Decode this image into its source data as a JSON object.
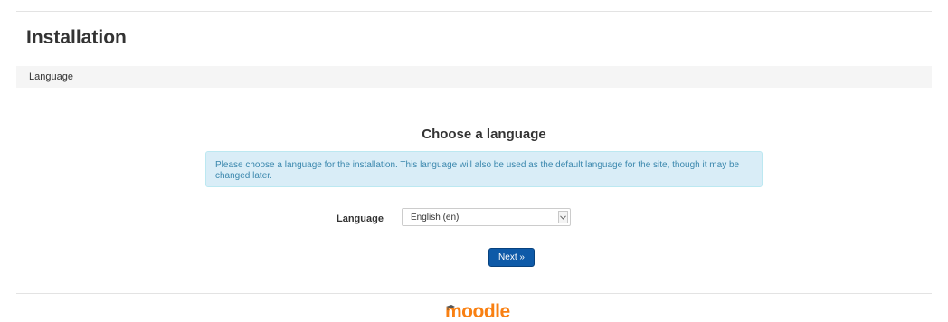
{
  "header": {
    "title": "Installation"
  },
  "breadcrumb": {
    "label": "Language"
  },
  "main": {
    "heading": "Choose a language",
    "info": "Please choose a language for the installation. This language will also be used as the default language for the site, though it may be changed later.",
    "language_label": "Language",
    "language_value": "English (en)",
    "next_label": "Next »"
  },
  "footer": {
    "logo_text": "moodle",
    "logo_icon": "graduation-cap-icon"
  },
  "colors": {
    "info_bg": "#d9edf7",
    "info_text": "#3a87ad",
    "button": "#0e5aa8",
    "logo": "#f98012"
  }
}
